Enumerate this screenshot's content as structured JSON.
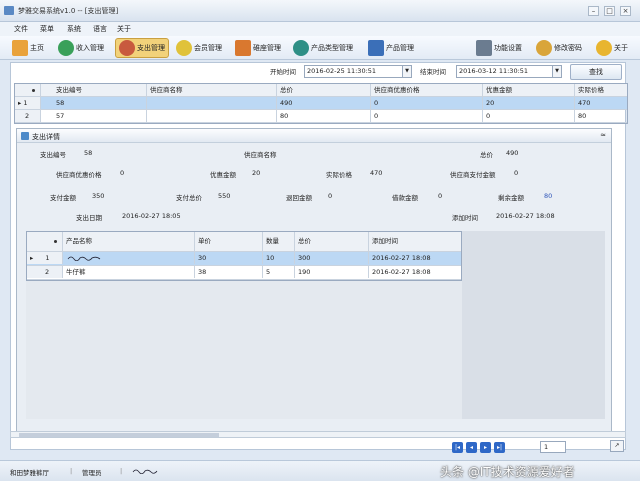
{
  "window": {
    "title": "梦雅交易系统v1.0 -- [支出管理]"
  },
  "menu": [
    "文件",
    "菜单",
    "系统",
    "语言",
    "关于"
  ],
  "toolbar": {
    "home": "主页",
    "income": "收入管理",
    "expense": "支出管理",
    "member": "会员管理",
    "warehouse": "碓座管理",
    "product_type": "产品类型管理",
    "product": "产品管理",
    "settings": "功能设置",
    "password": "修改密码",
    "about": "关于"
  },
  "filter": {
    "start_label": "开始时间",
    "start_value": "2016-02-25 11:30:51",
    "end_label": "结束时间",
    "end_value": "2016-03-12 11:30:51",
    "search_button": "查找"
  },
  "main_grid": {
    "headers": [
      "支出编号",
      "供应商名称",
      "总价",
      "供应商优惠价格",
      "优惠金额",
      "实际价格"
    ],
    "rows": [
      {
        "num": "1",
        "cells": [
          "58",
          "",
          "490",
          "0",
          "20",
          "470"
        ]
      },
      {
        "num": "2",
        "cells": [
          "57",
          "",
          "80",
          "0",
          "0",
          "80"
        ]
      }
    ]
  },
  "detail": {
    "title": "支出详情",
    "expense_no_label": "支出编号",
    "expense_no_value": "58",
    "supplier_name_label": "供应商名称",
    "supplier_name_value": "",
    "total_label": "总价",
    "total_value": "490",
    "supplier_discount_label": "供应商优惠价格",
    "supplier_discount_value": "0",
    "discount_amount_label": "优惠金额",
    "discount_amount_value": "20",
    "actual_price_label": "实际价格",
    "actual_price_value": "470",
    "supplier_paid_label": "供应商支付金额",
    "supplier_paid_value": "0",
    "paid_amount_label": "支付金额",
    "paid_amount_value": "350",
    "paid_total_label": "支付总价",
    "paid_total_value": "550",
    "refund_label": "退回金额",
    "refund_value": "0",
    "borrow_label": "借款金额",
    "borrow_value": "0",
    "remaining_label": "剩余金额",
    "remaining_value": "80",
    "date_label": "支出日期",
    "date_value": "2016-02-27 18:05",
    "added_label": "添加时间",
    "added_value": "2016-02-27 18:08"
  },
  "sub_grid": {
    "headers": [
      "产品名称",
      "单价",
      "数量",
      "总价",
      "添加时间"
    ],
    "rows": [
      {
        "num": "1",
        "cells": [
          "",
          "30",
          "10",
          "300",
          "2016-02-27 18:08"
        ]
      },
      {
        "num": "2",
        "cells": [
          "牛仔裤",
          "38",
          "5",
          "190",
          "2016-02-27 18:08"
        ]
      }
    ]
  },
  "pager": {
    "page": "1"
  },
  "status": {
    "company": "和田梦雅裤厅",
    "role": "管理员"
  },
  "watermark": "头条 @IT技术资源爱好者"
}
